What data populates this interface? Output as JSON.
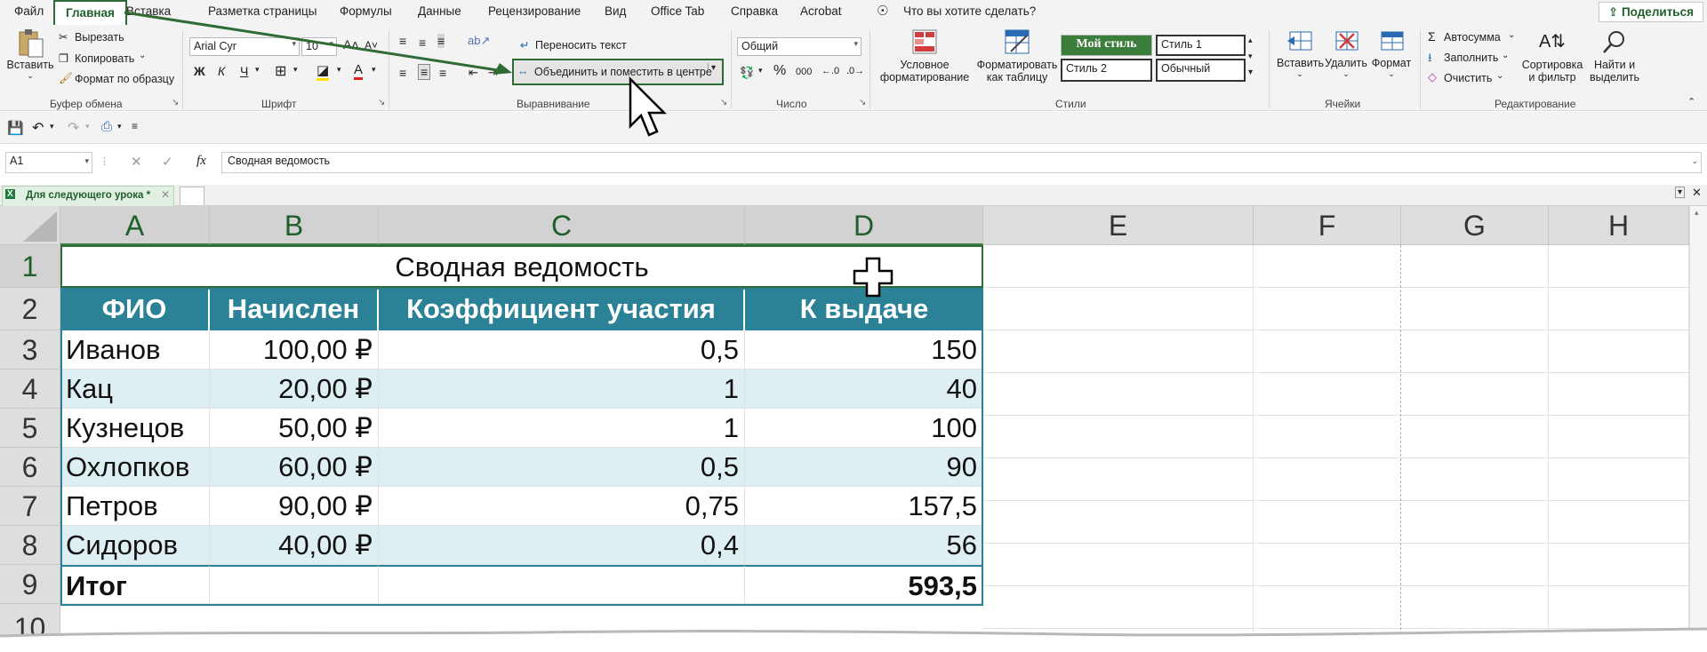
{
  "menu": {
    "tabs": [
      "Файл",
      "Главная",
      "Вставка",
      "Разметка страницы",
      "Формулы",
      "Данные",
      "Рецензирование",
      "Вид",
      "Office Tab",
      "Справка",
      "Acrobat"
    ],
    "search": "Что вы хотите сделать?",
    "share": "Поделиться"
  },
  "ribbon": {
    "clipboard": {
      "paste": "Вставить",
      "cut": "Вырезать",
      "copy": "Копировать",
      "format_painter": "Формат по образцу",
      "label": "Буфер обмена"
    },
    "font": {
      "name": "Arial Cyr",
      "size": "10",
      "bold": "Ж",
      "italic": "К",
      "underline": "Ч",
      "color_letter": "A",
      "label": "Шрифт"
    },
    "alignment": {
      "wrap": "Переносить текст",
      "merge": "Объединить и поместить в центре",
      "label": "Выравнивание"
    },
    "number": {
      "format": "Общий",
      "percent": "%",
      "thousands": "000",
      "label": "Число"
    },
    "styles": {
      "conditional_1": "Условное",
      "conditional_2": "форматирование",
      "table_1": "Форматировать",
      "table_2": "как таблицу",
      "my_style": "Мой стиль",
      "style1": "Стиль 1",
      "style2": "Стиль 2",
      "normal": "Обычный",
      "label": "Стили"
    },
    "cells": {
      "insert": "Вставить",
      "delete": "Удалить",
      "format": "Формат",
      "label": "Ячейки"
    },
    "editing": {
      "autosum": "Автосумма",
      "fill": "Заполнить",
      "clear": "Очистить",
      "sort_1": "Сортировка",
      "sort_2": "и фильтр",
      "find_1": "Найти и",
      "find_2": "выделить",
      "label": "Редактирование"
    }
  },
  "formula_bar": {
    "name_box": "A1",
    "fx": "fx",
    "content": "Сводная ведомость"
  },
  "workbook_tab": "Для следующего урока *",
  "columns": [
    "A",
    "B",
    "C",
    "D",
    "E",
    "F",
    "G",
    "H"
  ],
  "rows": [
    "1",
    "2",
    "3",
    "4",
    "5",
    "6",
    "7",
    "8",
    "9",
    "10"
  ],
  "table": {
    "title": "Сводная ведомость",
    "headers": [
      "ФИО",
      "Начислен",
      "Коэффициент участия",
      "К выдаче"
    ],
    "data": [
      [
        "Иванов",
        "100,00 ₽",
        "0,5",
        "150"
      ],
      [
        "Кац",
        "20,00 ₽",
        "1",
        "40"
      ],
      [
        "Кузнецов",
        "50,00 ₽",
        "1",
        "100"
      ],
      [
        "Охлопков",
        "60,00 ₽",
        "0,5",
        "90"
      ],
      [
        "Петров",
        "90,00 ₽",
        "0,75",
        "157,5"
      ],
      [
        "Сидоров",
        "40,00 ₽",
        "0,4",
        "56"
      ]
    ],
    "total_label": "Итог",
    "total_value": "593,5"
  },
  "colors": {
    "accent": "#2f6b35",
    "header_fill": "#2b8196",
    "band_fill": "#ddeff3"
  }
}
